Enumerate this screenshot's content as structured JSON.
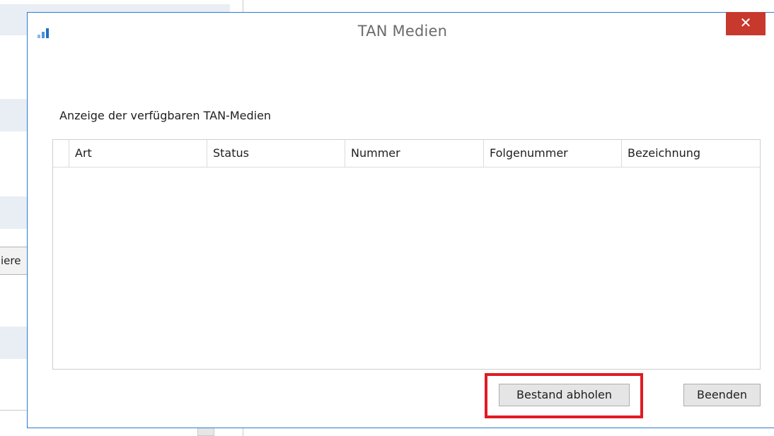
{
  "background": {
    "partial_button_label": "iere"
  },
  "dialog": {
    "title": "TAN Medien",
    "close_glyph": "✕",
    "app_icon": "signal-bars-icon",
    "section_label": "Anzeige der verfügbaren TAN-Medien",
    "table": {
      "columns": [
        "Art",
        "Status",
        "Nummer",
        "Folgenummer",
        "Bezeichnung"
      ],
      "rows": []
    },
    "buttons": {
      "fetch_label": "Bestand abholen",
      "quit_label": "Beenden"
    },
    "highlight_color": "#e01b24",
    "accent_color": "#2c7bd0",
    "close_color": "#c7392c"
  }
}
